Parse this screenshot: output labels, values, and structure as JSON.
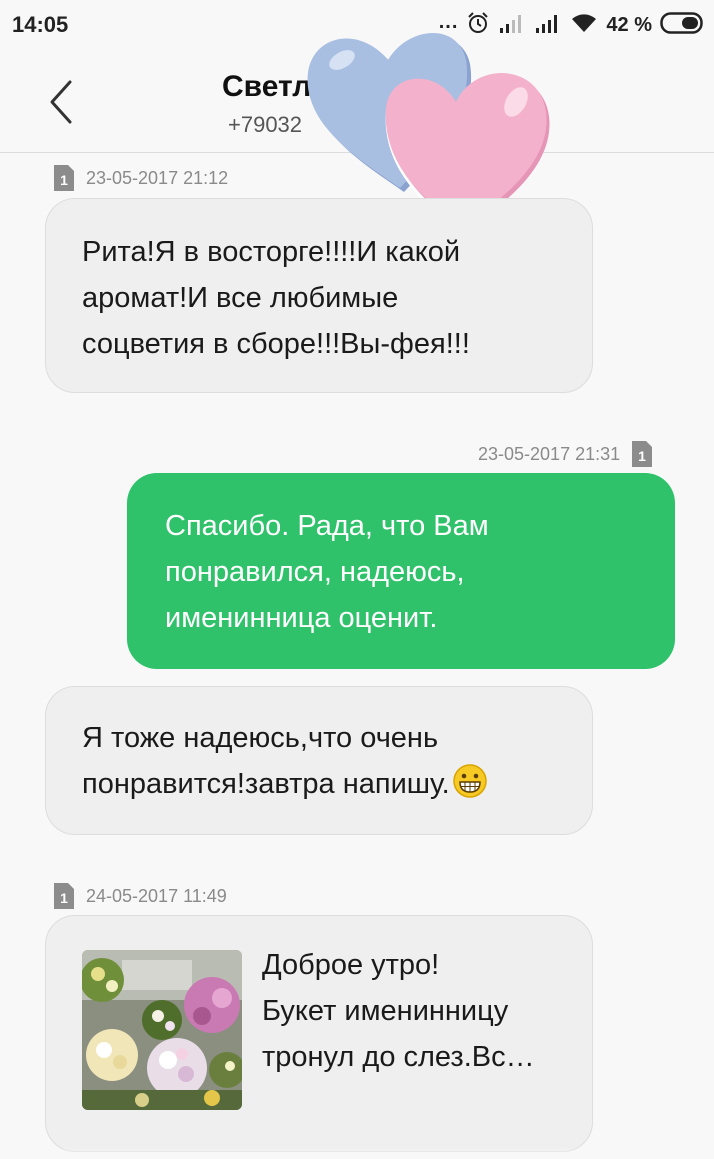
{
  "status_bar": {
    "time": "14:05",
    "dots": "...",
    "battery_percent": "42 %"
  },
  "header": {
    "contact_name": "Светл",
    "contact_phone": "+79032"
  },
  "messages": [
    {
      "direction": "incoming",
      "sim": "1",
      "timestamp": "23-05-2017 21:12",
      "lines": [
        "Рита!Я в восторге!!!!И какой",
        "аромат!И все любимые",
        "соцветия в сборе!!!Вы-фея!!!"
      ]
    },
    {
      "direction": "outgoing",
      "sim": "1",
      "timestamp": "23-05-2017 21:31",
      "lines": [
        "Спасибо. Рада, что Вам",
        "понравился, надеюсь,",
        "именинница оценит."
      ]
    },
    {
      "direction": "incoming",
      "lines": [
        "Я тоже надеюсь,что очень",
        "понравится!завтра напишу."
      ],
      "emoji": "grinning-face"
    },
    {
      "direction": "incoming",
      "sim": "1",
      "timestamp": "24-05-2017 11:49",
      "attachment": "flowers-photo",
      "lines": [
        "Доброе утро!",
        "Букет именинницу",
        "тронул до слез.Вс…"
      ]
    }
  ],
  "colors": {
    "outgoing_bubble": "#2fc26a",
    "incoming_bubble": "#efefef",
    "heart_blue": "#a9bfe2",
    "heart_pink": "#f4b1cb"
  }
}
